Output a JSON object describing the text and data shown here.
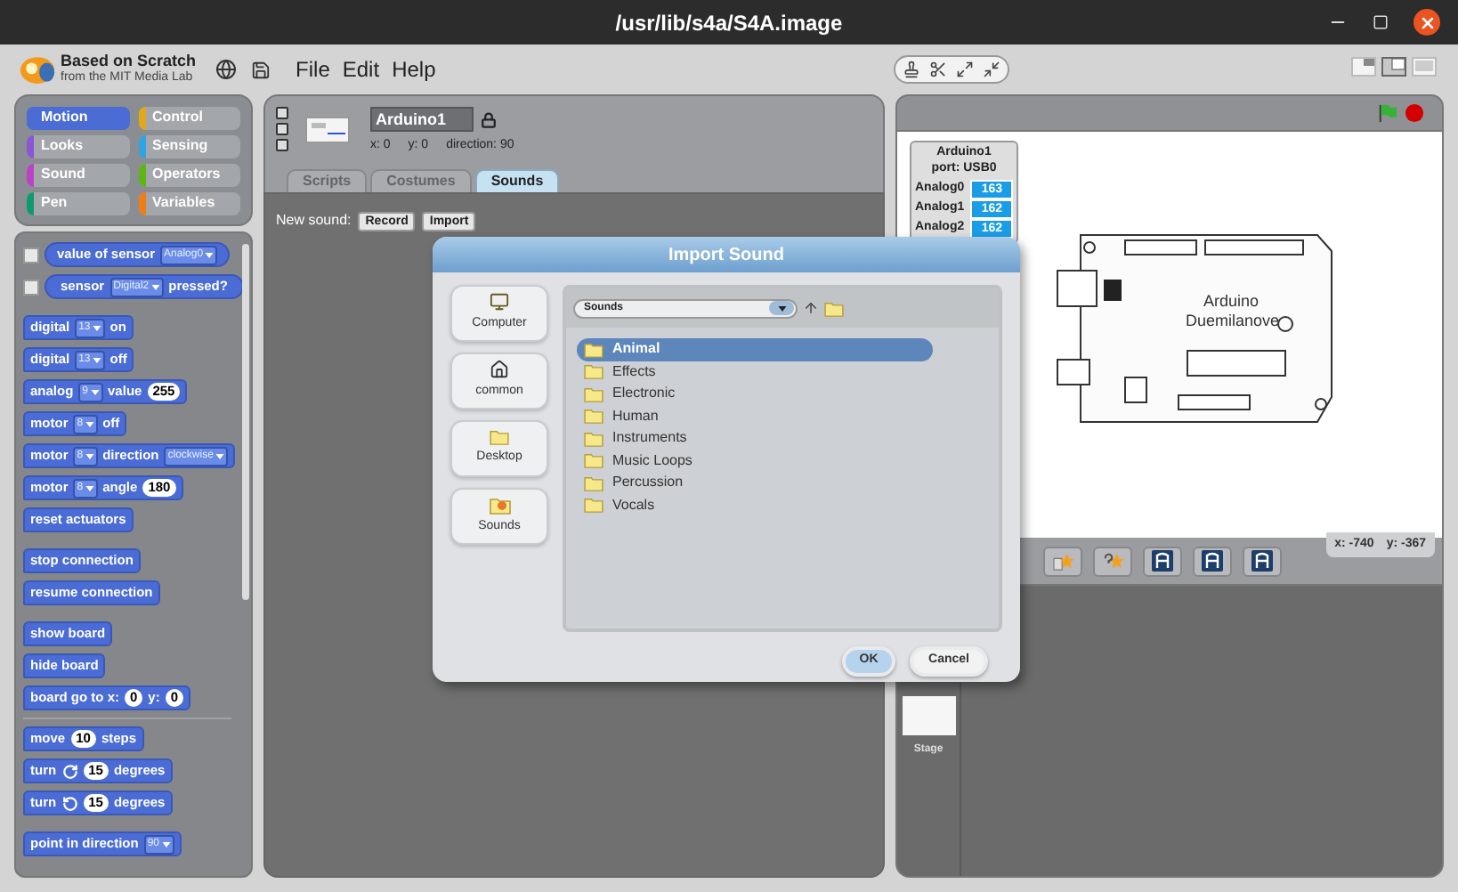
{
  "window": {
    "title": "/usr/lib/s4a/S4A.image"
  },
  "logo": {
    "title": "Based on Scratch",
    "subtitle": "from the MIT Media Lab"
  },
  "menu": [
    "File",
    "Edit",
    "Help"
  ],
  "view_modes": [
    {
      "selected": false
    },
    {
      "selected": true
    },
    {
      "selected": false
    }
  ],
  "categories": [
    {
      "label": "Motion",
      "color": "#4a6cd4",
      "selected": true
    },
    {
      "label": "Control",
      "color": "#e1a91a",
      "selected": false
    },
    {
      "label": "Looks",
      "color": "#8a55d7",
      "selected": false
    },
    {
      "label": "Sensing",
      "color": "#2ca5e2",
      "selected": false
    },
    {
      "label": "Sound",
      "color": "#bb42c3",
      "selected": false
    },
    {
      "label": "Operators",
      "color": "#5cb712",
      "selected": false
    },
    {
      "label": "Pen",
      "color": "#0e9a6c",
      "selected": false
    },
    {
      "label": "Variables",
      "color": "#ee7d16",
      "selected": false
    }
  ],
  "palette": {
    "sections": [
      {
        "kind": "blocks",
        "blocks": [
          {
            "kind": "reporter",
            "checked": false,
            "parts": [
              {
                "kind": "text",
                "text": "value of sensor"
              },
              {
                "kind": "dropdown",
                "text": "Analog0"
              }
            ]
          },
          {
            "kind": "boolean",
            "checked": false,
            "parts": [
              {
                "kind": "text",
                "text": "sensor"
              },
              {
                "kind": "dropdown",
                "text": "Digital2"
              },
              {
                "kind": "text",
                "text": "pressed?"
              }
            ]
          }
        ]
      },
      {
        "kind": "blocks",
        "blocks": [
          {
            "kind": "command",
            "parts": [
              {
                "kind": "text",
                "text": "digital"
              },
              {
                "kind": "dropdown",
                "text": "13"
              },
              {
                "kind": "text",
                "text": "on"
              }
            ]
          },
          {
            "kind": "command",
            "parts": [
              {
                "kind": "text",
                "text": "digital"
              },
              {
                "kind": "dropdown",
                "text": "13"
              },
              {
                "kind": "text",
                "text": "off"
              }
            ]
          },
          {
            "kind": "command",
            "parts": [
              {
                "kind": "text",
                "text": "analog"
              },
              {
                "kind": "dropdown",
                "text": "9"
              },
              {
                "kind": "text",
                "text": "value"
              },
              {
                "kind": "number",
                "text": "255"
              }
            ]
          },
          {
            "kind": "command",
            "parts": [
              {
                "kind": "text",
                "text": "motor"
              },
              {
                "kind": "dropdown",
                "text": "8"
              },
              {
                "kind": "text",
                "text": "off"
              }
            ]
          },
          {
            "kind": "command",
            "parts": [
              {
                "kind": "text",
                "text": "motor"
              },
              {
                "kind": "dropdown",
                "text": "8"
              },
              {
                "kind": "text",
                "text": "direction"
              },
              {
                "kind": "dropdown",
                "text": "clockwise"
              }
            ]
          },
          {
            "kind": "command",
            "parts": [
              {
                "kind": "text",
                "text": "motor"
              },
              {
                "kind": "dropdown",
                "text": "8"
              },
              {
                "kind": "text",
                "text": "angle"
              },
              {
                "kind": "number",
                "text": "180"
              }
            ]
          },
          {
            "kind": "command",
            "parts": [
              {
                "kind": "text",
                "text": "reset actuators"
              }
            ]
          }
        ]
      },
      {
        "kind": "blocks",
        "blocks": [
          {
            "kind": "command",
            "parts": [
              {
                "kind": "text",
                "text": "stop connection"
              }
            ]
          },
          {
            "kind": "command",
            "parts": [
              {
                "kind": "text",
                "text": "resume connection"
              }
            ]
          }
        ]
      },
      {
        "kind": "blocks",
        "blocks": [
          {
            "kind": "command",
            "parts": [
              {
                "kind": "text",
                "text": "show board"
              }
            ]
          },
          {
            "kind": "command",
            "parts": [
              {
                "kind": "text",
                "text": "hide board"
              }
            ]
          },
          {
            "kind": "command",
            "parts": [
              {
                "kind": "text",
                "text": "board go to x:"
              },
              {
                "kind": "number",
                "text": "0"
              },
              {
                "kind": "text",
                "text": "y:"
              },
              {
                "kind": "number",
                "text": "0"
              }
            ]
          }
        ]
      },
      {
        "kind": "divider"
      },
      {
        "kind": "blocks",
        "blocks": [
          {
            "kind": "command",
            "parts": [
              {
                "kind": "text",
                "text": "move"
              },
              {
                "kind": "number",
                "text": "10"
              },
              {
                "kind": "text",
                "text": "steps"
              }
            ]
          },
          {
            "kind": "command",
            "parts": [
              {
                "kind": "text",
                "text": "turn"
              },
              {
                "kind": "icon_cw"
              },
              {
                "kind": "number",
                "text": "15"
              },
              {
                "kind": "text",
                "text": "degrees"
              }
            ]
          },
          {
            "kind": "command",
            "parts": [
              {
                "kind": "text",
                "text": "turn"
              },
              {
                "kind": "icon_ccw"
              },
              {
                "kind": "number",
                "text": "15"
              },
              {
                "kind": "text",
                "text": "degrees"
              }
            ]
          }
        ]
      },
      {
        "kind": "blocks",
        "blocks": [
          {
            "kind": "command",
            "parts": [
              {
                "kind": "text",
                "text": "point in direction"
              },
              {
                "kind": "dropdown",
                "text": "90"
              }
            ]
          }
        ]
      }
    ]
  },
  "sprite": {
    "name": "Arduino1",
    "x": "x: 0",
    "y": "y: 0",
    "direction": "direction: 90"
  },
  "tabs": [
    {
      "label": "Scripts",
      "selected": false
    },
    {
      "label": "Costumes",
      "selected": false
    },
    {
      "label": "Sounds",
      "selected": true
    }
  ],
  "sounds_pane": {
    "label": "New sound:",
    "buttons": [
      "Record",
      "Import"
    ]
  },
  "stage": {
    "sensor_board": {
      "title": "Arduino1",
      "port": "port: USB0",
      "sensors": [
        {
          "name": "Analog0",
          "value": "163"
        },
        {
          "name": "Analog1",
          "value": "162"
        },
        {
          "name": "Analog2",
          "value": "162"
        }
      ]
    },
    "board_labels": [
      "Arduino",
      "Duemilanove"
    ]
  },
  "coords": {
    "x": "x: -740",
    "y": "y: -367"
  },
  "stage_thumb": {
    "label": "Stage"
  },
  "dialog": {
    "title": "Import Sound",
    "places": [
      {
        "label": "Computer",
        "kind": "computer"
      },
      {
        "label": "common",
        "kind": "home"
      },
      {
        "label": "Desktop",
        "kind": "folder"
      },
      {
        "label": "Sounds",
        "kind": "sounds"
      }
    ],
    "path": "Sounds",
    "files": [
      {
        "name": "Animal",
        "selected": true
      },
      {
        "name": "Effects",
        "selected": false
      },
      {
        "name": "Electronic",
        "selected": false
      },
      {
        "name": "Human",
        "selected": false
      },
      {
        "name": "Instruments",
        "selected": false
      },
      {
        "name": "Music Loops",
        "selected": false
      },
      {
        "name": "Percussion",
        "selected": false
      },
      {
        "name": "Vocals",
        "selected": false
      }
    ],
    "buttons": [
      "OK",
      "Cancel"
    ]
  }
}
